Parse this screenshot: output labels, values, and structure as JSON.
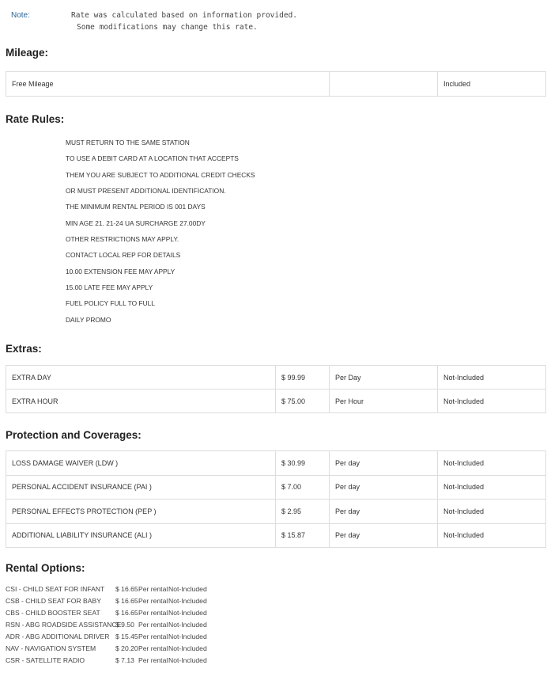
{
  "note": {
    "label": "Note:",
    "line1": "Rate was calculated based on information provided.",
    "line2": "Some modifications may change this rate."
  },
  "mileage": {
    "title": "Mileage:",
    "row": {
      "name": "Free Mileage",
      "value": "",
      "status": "Included"
    }
  },
  "rate_rules": {
    "title": "Rate Rules:",
    "lines": [
      "MUST RETURN TO THE SAME STATION",
      "TO USE A DEBIT CARD AT A LOCATION THAT ACCEPTS",
      "THEM YOU ARE SUBJECT TO ADDITIONAL CREDIT CHECKS",
      "OR MUST PRESENT ADDITIONAL IDENTIFICATION.",
      "THE MINIMUM RENTAL PERIOD IS 001 DAYS",
      "MIN AGE 21. 21-24 UA SURCHARGE 27.00DY",
      "OTHER RESTRICTIONS MAY APPLY.",
      "CONTACT LOCAL REP FOR DETAILS",
      "10.00 EXTENSION FEE MAY APPLY",
      "15.00 LATE FEE MAY APPLY",
      "FUEL POLICY FULL TO FULL",
      "DAILY PROMO"
    ]
  },
  "extras": {
    "title": "Extras:",
    "rows": [
      {
        "name": "EXTRA DAY",
        "price": "$ 99.99",
        "unit": "Per Day",
        "status": "Not-Included"
      },
      {
        "name": "EXTRA HOUR",
        "price": "$ 75.00",
        "unit": "Per Hour",
        "status": "Not-Included"
      }
    ]
  },
  "protection": {
    "title": "Protection and Coverages:",
    "rows": [
      {
        "name": "LOSS DAMAGE WAIVER (LDW )",
        "price": "$ 30.99",
        "unit": "Per day",
        "status": "Not-Included"
      },
      {
        "name": "PERSONAL ACCIDENT INSURANCE (PAI )",
        "price": "$ 7.00",
        "unit": "Per day",
        "status": "Not-Included"
      },
      {
        "name": "PERSONAL EFFECTS PROTECTION (PEP )",
        "price": "$ 2.95",
        "unit": "Per day",
        "status": "Not-Included"
      },
      {
        "name": "ADDITIONAL LIABILITY INSURANCE (ALI )",
        "price": "$ 15.87",
        "unit": "Per day",
        "status": "Not-Included"
      }
    ]
  },
  "rental_options": {
    "title": "Rental Options:",
    "rows": [
      {
        "name": "CSI - CHILD SEAT FOR INFANT",
        "price": "$ 16.65",
        "unit": "Per rental",
        "status": "Not-Included"
      },
      {
        "name": "CSB - CHILD SEAT FOR BABY",
        "price": "$ 16.65",
        "unit": "Per rental",
        "status": "Not-Included"
      },
      {
        "name": "CBS - CHILD BOOSTER SEAT",
        "price": "$ 16.65",
        "unit": "Per rental",
        "status": "Not-Included"
      },
      {
        "name": "RSN - ABG ROADSIDE ASSISTANCE",
        "price": "$ 9.50",
        "unit": "Per rental",
        "status": "Not-Included"
      },
      {
        "name": "ADR - ABG ADDITIONAL DRIVER",
        "price": "$ 15.45",
        "unit": "Per rental",
        "status": "Not-Included"
      },
      {
        "name": "NAV - NAVIGATION SYSTEM",
        "price": "$ 20.20",
        "unit": "Per rental",
        "status": "Not-Included"
      },
      {
        "name": "CSR - SATELLITE RADIO",
        "price": "$ 7.13",
        "unit": "Per rental",
        "status": "Not-Included"
      }
    ]
  }
}
